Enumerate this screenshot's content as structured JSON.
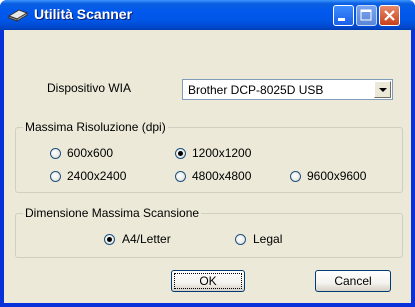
{
  "window": {
    "title": "Utilità Scanner"
  },
  "device": {
    "label": "Dispositivo WIA",
    "selected": "Brother DCP-8025D USB"
  },
  "resolution": {
    "title": "Massima Risoluzione (dpi)",
    "options": [
      "600x600",
      "1200x1200",
      "2400x2400",
      "4800x4800",
      "9600x9600"
    ],
    "selected": "1200x1200"
  },
  "scan_size": {
    "title": "Dimensione Massima Scansione",
    "options": [
      "A4/Letter",
      "Legal"
    ],
    "selected": "A4/Letter"
  },
  "buttons": {
    "ok": "OK",
    "cancel": "Cancel"
  }
}
